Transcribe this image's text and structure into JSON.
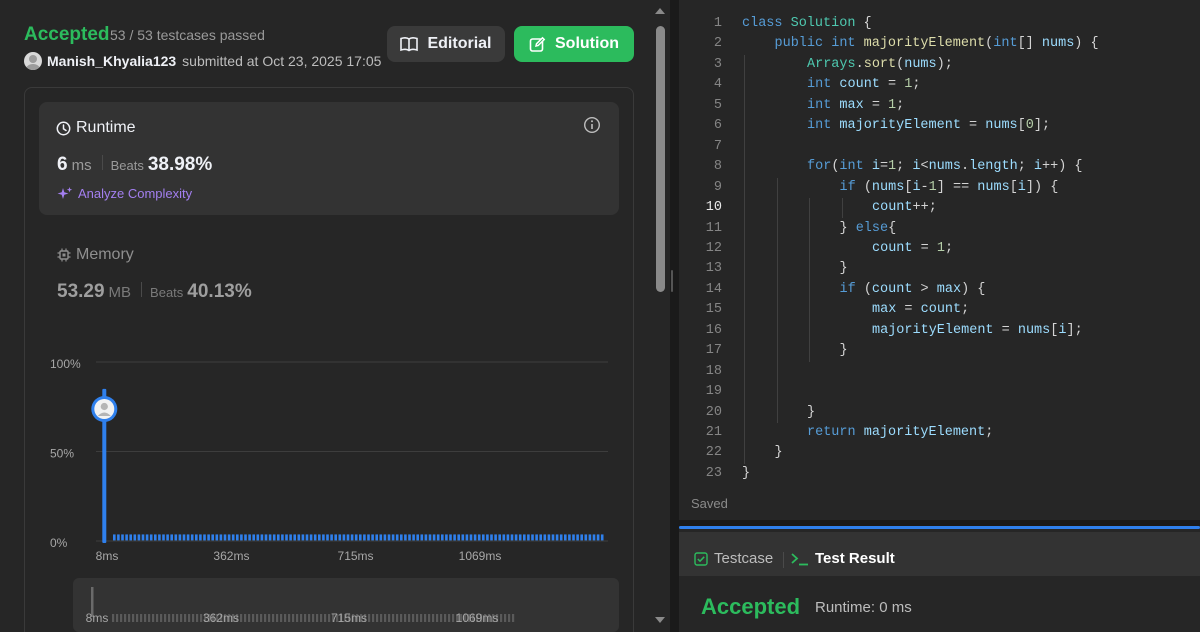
{
  "submission": {
    "status": "Accepted",
    "testcases": "53 / 53 testcases passed",
    "username": "Manish_Khyalia123",
    "submitted_text": "submitted at Oct 23, 2025 17:05"
  },
  "buttons": {
    "editorial": "Editorial",
    "solution": "Solution"
  },
  "runtime": {
    "title": "Runtime",
    "value": "6",
    "unit": "ms",
    "beats_label": "Beats",
    "beats_pct": "38.98%",
    "analyze_label": "Analyze Complexity"
  },
  "memory": {
    "title": "Memory",
    "value": "53.29",
    "unit": "MB",
    "beats_label": "Beats",
    "beats_pct": "40.13%"
  },
  "chart_data": {
    "type": "bar",
    "y_ticks": [
      "100%",
      "50%",
      "0%"
    ],
    "ylim": [
      0,
      100
    ],
    "x_tick_labels": [
      "8ms",
      "362ms",
      "715ms",
      "1069ms"
    ],
    "x_tick_values": [
      8,
      362,
      715,
      1069
    ],
    "highlight": {
      "x": 6,
      "y": 85,
      "marker": "avatar-icon"
    },
    "baseline_value": 2,
    "baseline_range": [
      8,
      1380
    ],
    "navigator_labels": [
      "8ms",
      "362ms",
      "715ms",
      "1069ms"
    ],
    "colors": {
      "bar": "#2f80ed",
      "grid": "#3d3d3d"
    }
  },
  "editor": {
    "active_line": 10,
    "saved_label": "Saved",
    "lines": [
      {
        "n": 1,
        "indent": 0,
        "tokens": [
          [
            "kw",
            "class "
          ],
          [
            "ty",
            "Solution"
          ],
          [
            "pu",
            " {"
          ]
        ]
      },
      {
        "n": 2,
        "indent": 1,
        "tokens": [
          [
            "kw",
            "public "
          ],
          [
            "kw",
            "int "
          ],
          [
            "fn",
            "majorityElement"
          ],
          [
            "pu",
            "("
          ],
          [
            "kw",
            "int"
          ],
          [
            "pu",
            "[] "
          ],
          [
            "va",
            "nums"
          ],
          [
            "pu",
            ") {"
          ]
        ]
      },
      {
        "n": 3,
        "indent": 2,
        "tokens": [
          [
            "ty",
            "Arrays"
          ],
          [
            "pu",
            "."
          ],
          [
            "fn",
            "sort"
          ],
          [
            "pu",
            "("
          ],
          [
            "va",
            "nums"
          ],
          [
            "pu",
            ");"
          ]
        ]
      },
      {
        "n": 4,
        "indent": 2,
        "tokens": [
          [
            "kw",
            "int "
          ],
          [
            "va",
            "count"
          ],
          [
            "pu",
            " = "
          ],
          [
            "nu",
            "1"
          ],
          [
            "pu",
            ";"
          ]
        ]
      },
      {
        "n": 5,
        "indent": 2,
        "tokens": [
          [
            "kw",
            "int "
          ],
          [
            "va",
            "max"
          ],
          [
            "pu",
            " = "
          ],
          [
            "nu",
            "1"
          ],
          [
            "pu",
            ";"
          ]
        ]
      },
      {
        "n": 6,
        "indent": 2,
        "tokens": [
          [
            "kw",
            "int "
          ],
          [
            "va",
            "majorityElement"
          ],
          [
            "pu",
            " = "
          ],
          [
            "va",
            "nums"
          ],
          [
            "pu",
            "["
          ],
          [
            "nu",
            "0"
          ],
          [
            "pu",
            "];"
          ]
        ]
      },
      {
        "n": 7,
        "indent": 0,
        "tokens": []
      },
      {
        "n": 8,
        "indent": 2,
        "tokens": [
          [
            "kw",
            "for"
          ],
          [
            "pu",
            "("
          ],
          [
            "kw",
            "int "
          ],
          [
            "va",
            "i"
          ],
          [
            "pu",
            "="
          ],
          [
            "nu",
            "1"
          ],
          [
            "pu",
            "; "
          ],
          [
            "va",
            "i"
          ],
          [
            "pu",
            "<"
          ],
          [
            "va",
            "nums"
          ],
          [
            "pu",
            "."
          ],
          [
            "va",
            "length"
          ],
          [
            "pu",
            "; "
          ],
          [
            "va",
            "i"
          ],
          [
            "pu",
            "++) {"
          ]
        ]
      },
      {
        "n": 9,
        "indent": 3,
        "tokens": [
          [
            "kw",
            "if "
          ],
          [
            "pu",
            "("
          ],
          [
            "va",
            "nums"
          ],
          [
            "pu",
            "["
          ],
          [
            "va",
            "i"
          ],
          [
            "pu",
            "-"
          ],
          [
            "nu",
            "1"
          ],
          [
            "pu",
            "] == "
          ],
          [
            "va",
            "nums"
          ],
          [
            "pu",
            "["
          ],
          [
            "va",
            "i"
          ],
          [
            "pu",
            "]) {"
          ]
        ]
      },
      {
        "n": 10,
        "indent": 4,
        "tokens": [
          [
            "va",
            "count"
          ],
          [
            "pu",
            "++;"
          ]
        ]
      },
      {
        "n": 11,
        "indent": 3,
        "tokens": [
          [
            "pu",
            "} "
          ],
          [
            "kw",
            "else"
          ],
          [
            "pu",
            "{"
          ]
        ]
      },
      {
        "n": 12,
        "indent": 4,
        "tokens": [
          [
            "va",
            "count"
          ],
          [
            "pu",
            " = "
          ],
          [
            "nu",
            "1"
          ],
          [
            "pu",
            ";"
          ]
        ]
      },
      {
        "n": 13,
        "indent": 3,
        "tokens": [
          [
            "pu",
            "}"
          ]
        ]
      },
      {
        "n": 14,
        "indent": 3,
        "tokens": [
          [
            "kw",
            "if "
          ],
          [
            "pu",
            "("
          ],
          [
            "va",
            "count"
          ],
          [
            "pu",
            " > "
          ],
          [
            "va",
            "max"
          ],
          [
            "pu",
            ") {"
          ]
        ]
      },
      {
        "n": 15,
        "indent": 4,
        "tokens": [
          [
            "va",
            "max"
          ],
          [
            "pu",
            " = "
          ],
          [
            "va",
            "count"
          ],
          [
            "pu",
            ";"
          ]
        ]
      },
      {
        "n": 16,
        "indent": 4,
        "tokens": [
          [
            "va",
            "majorityElement"
          ],
          [
            "pu",
            " = "
          ],
          [
            "va",
            "nums"
          ],
          [
            "pu",
            "["
          ],
          [
            "va",
            "i"
          ],
          [
            "pu",
            "];"
          ]
        ]
      },
      {
        "n": 17,
        "indent": 3,
        "tokens": [
          [
            "pu",
            "}"
          ]
        ]
      },
      {
        "n": 18,
        "indent": 0,
        "tokens": []
      },
      {
        "n": 19,
        "indent": 0,
        "tokens": []
      },
      {
        "n": 20,
        "indent": 2,
        "tokens": [
          [
            "pu",
            "}"
          ]
        ]
      },
      {
        "n": 21,
        "indent": 2,
        "tokens": [
          [
            "kw",
            "return "
          ],
          [
            "va",
            "majorityElement"
          ],
          [
            "pu",
            ";"
          ]
        ]
      },
      {
        "n": 22,
        "indent": 1,
        "tokens": [
          [
            "pu",
            "}"
          ]
        ]
      },
      {
        "n": 23,
        "indent": 0,
        "tokens": [
          [
            "pu",
            "}"
          ]
        ]
      }
    ]
  },
  "results": {
    "tab_testcase": "Testcase",
    "tab_result": "Test Result",
    "status": "Accepted",
    "runtime": "Runtime: 0 ms"
  }
}
